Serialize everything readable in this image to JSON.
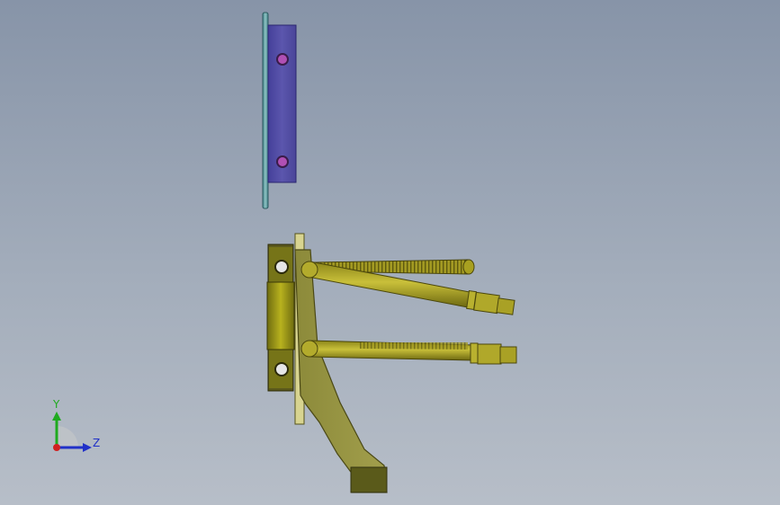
{
  "viewport": {
    "background_top": "#8794a8",
    "background_bottom": "#b7bec8"
  },
  "parts": {
    "mounting_plate": {
      "plate_color": "#5a55a8",
      "flange_color": "#6fa8a8",
      "hole_color": "#b04cb0"
    },
    "pedal_assembly": {
      "body_color": "#8c8a36",
      "bracket_color": "#9a9820",
      "rod_color": "#b0a828"
    }
  },
  "triad": {
    "y_label": "Y",
    "z_label": "Z",
    "y_color": "#1faa1f",
    "z_color": "#2030c8",
    "x_color": "#d02020"
  }
}
